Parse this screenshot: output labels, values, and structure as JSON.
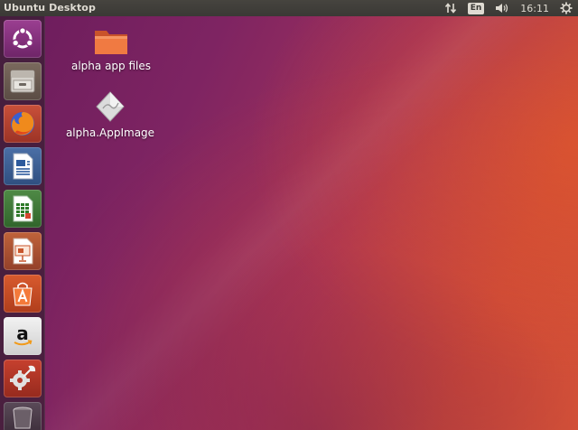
{
  "top_panel": {
    "title": "Ubuntu Desktop",
    "language": "En",
    "clock": "16:11"
  },
  "launcher": {
    "items": [
      {
        "name": "dash",
        "icon": "ubuntu-logo-icon"
      },
      {
        "name": "files",
        "icon": "file-cabinet-icon"
      },
      {
        "name": "firefox",
        "icon": "firefox-icon"
      },
      {
        "name": "writer",
        "icon": "document-icon"
      },
      {
        "name": "calc",
        "icon": "spreadsheet-icon"
      },
      {
        "name": "impress",
        "icon": "presentation-icon"
      },
      {
        "name": "software",
        "icon": "shopping-bag-icon"
      },
      {
        "name": "amazon",
        "icon": "amazon-icon"
      },
      {
        "name": "settings",
        "icon": "gear-wrench-icon"
      },
      {
        "name": "trash",
        "icon": "trash-icon"
      }
    ]
  },
  "desktop": {
    "icons": [
      {
        "label": "alpha app files",
        "icon": "folder-icon"
      },
      {
        "label": "alpha.AppImage",
        "icon": "appimage-icon"
      }
    ]
  },
  "colors": {
    "panel": "#3c3b37",
    "ubuntu_orange": "#e95420",
    "aubergine": "#77216f"
  }
}
